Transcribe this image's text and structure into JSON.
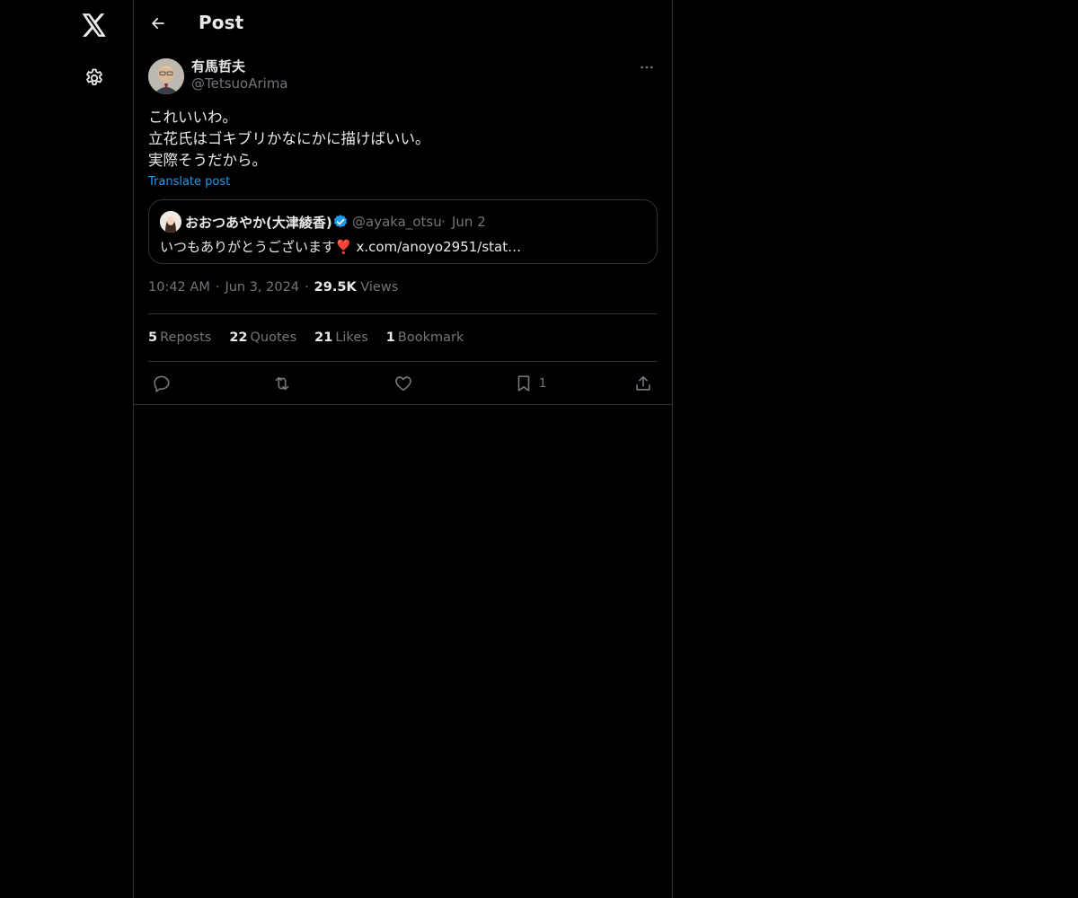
{
  "nav": {
    "logo_icon": "x-logo-icon",
    "settings_icon": "gear-icon"
  },
  "header": {
    "title": "Post",
    "back_icon": "arrow-left-icon"
  },
  "post": {
    "author": {
      "name": "有馬哲夫",
      "handle": "@TetsuoArima"
    },
    "text_lines": [
      "これいいわ。",
      "立花氏はゴキブリかなにかに描けばいい。",
      "実際そうだから。"
    ],
    "translate_label": "Translate post",
    "quote": {
      "name": "おおつあやか(大津綾香)",
      "handle": "@ayaka_otsu",
      "separator": "·",
      "date": "Jun 2",
      "text": "いつもありがとうございます❣️ x.com/anoyo2951/stat…"
    },
    "meta": {
      "time": "10:42 AM",
      "date": "Jun 3, 2024",
      "separator": "·",
      "views_count": "29.5K",
      "views_label": "Views"
    },
    "stats": {
      "reposts_count": "5",
      "reposts_label": "Reposts",
      "quotes_count": "22",
      "quotes_label": "Quotes",
      "likes_count": "21",
      "likes_label": "Likes",
      "bookmarks_count": "1",
      "bookmarks_label": "Bookmark"
    },
    "actions": {
      "bookmark_count": "1"
    }
  },
  "colors": {
    "background": "#000000",
    "text": "#e7e9ea",
    "muted": "#71767b",
    "border": "#2f3336",
    "accent": "#1d9bf0"
  }
}
